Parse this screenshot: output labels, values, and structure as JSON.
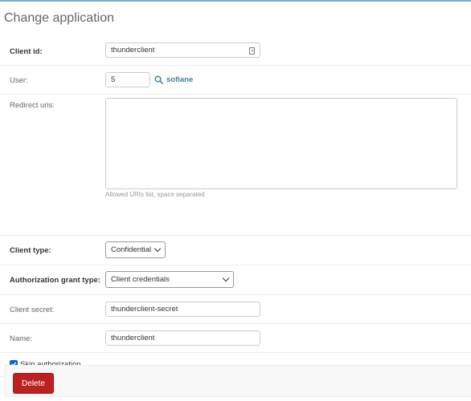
{
  "page": {
    "title": "Change application"
  },
  "fields": {
    "client_id": {
      "label": "Client id:",
      "value": "thunderclient"
    },
    "user": {
      "label": "User:",
      "value": "5",
      "link_text": "sofiane"
    },
    "redirect_uris": {
      "label": "Redirect uris:",
      "value": "",
      "help": "Allowed URIs list, space separated"
    },
    "client_type": {
      "label": "Client type:",
      "selected": "Confidential"
    },
    "grant_type": {
      "label": "Authorization grant type:",
      "selected": "Client credentials"
    },
    "client_secret": {
      "label": "Client secret:",
      "value": "thunderclient-secret"
    },
    "name": {
      "label": "Name:",
      "value": "thunderclient"
    },
    "skip_authorization": {
      "label": "Skip authorization",
      "checked": true
    }
  },
  "actions": {
    "delete_label": "Delete"
  },
  "icons": [
    "search-icon",
    "password-key-icon",
    "chevron-down-icon",
    "checkmark-icon"
  ],
  "colors": {
    "accent": "#79aec8",
    "link": "#447e9b",
    "delete": "#ba2121",
    "checkbox": "#0b64d0"
  }
}
